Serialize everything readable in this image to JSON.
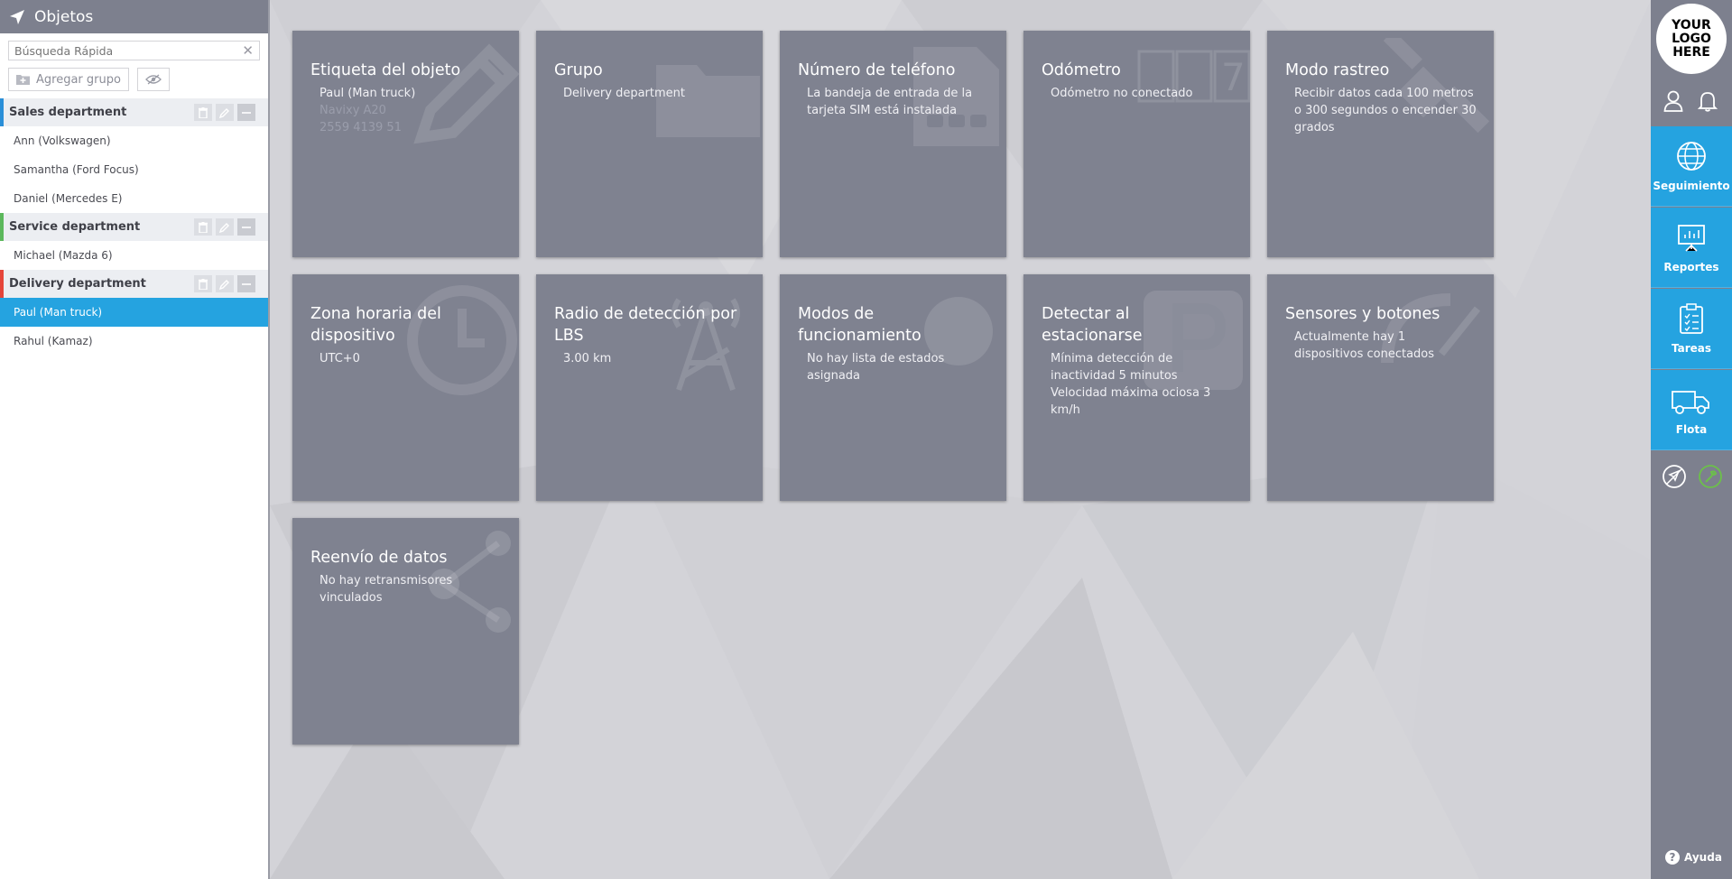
{
  "sidebar": {
    "title": "Objetos",
    "search_placeholder": "Búsqueda Rápida",
    "add_group_label": "Agregar grupo",
    "groups": [
      {
        "name": "Sales department",
        "color": "#2a8fd8",
        "objects": [
          "Ann (Volkswagen)",
          "Samantha (Ford Focus)",
          "Daniel (Mercedes E)"
        ]
      },
      {
        "name": "Service department",
        "color": "#5cb85c",
        "objects": [
          "Michael (Mazda 6)"
        ]
      },
      {
        "name": "Delivery department",
        "color": "#e5453a",
        "objects": [
          "Paul (Man truck)",
          "Rahul (Kamaz)"
        ]
      }
    ],
    "selected_object": "Paul (Man truck)"
  },
  "tiles": [
    {
      "title": "Etiqueta del objeto",
      "desc": "Paul (Man truck)",
      "desc_muted": [
        "Navixy A20",
        "2559 4139 51"
      ],
      "icon": "pencil-icon"
    },
    {
      "title": "Grupo",
      "desc": "Delivery department",
      "icon": "folder-icon"
    },
    {
      "title": "Número de teléfono",
      "desc": "La bandeja de entrada de la tarjeta SIM está instalada",
      "icon": "sim-card-icon"
    },
    {
      "title": "Odómetro",
      "desc": "Odómetro no conectado",
      "icon": "odometer-icon"
    },
    {
      "title": "Modo rastreo",
      "desc": "Recibir datos cada 100 metros o 300 segundos o encender 30 grados",
      "icon": "satellite-icon"
    },
    {
      "title": "Zona horaria del dispositivo",
      "desc": "UTC+0",
      "icon": "clock-icon"
    },
    {
      "title": "Radio de detección por LBS",
      "desc": "3.00 km",
      "icon": "antenna-icon"
    },
    {
      "title": "Modos de funcionamiento",
      "desc": "No hay lista de estados asignada",
      "icon": "circle-icon"
    },
    {
      "title": "Detectar al estacionarse",
      "desc_lines": [
        "Mínima detección de inactividad 5 minutos",
        "Velocidad máxima ociosa 3 km/h"
      ],
      "icon": "parking-icon"
    },
    {
      "title": "Sensores y botones",
      "desc": "Actualmente hay 1 dispositivos conectados",
      "icon": "gauge-icon"
    },
    {
      "title": "Reenvío de datos",
      "desc": "No hay retransmisores vinculados",
      "icon": "share-icon"
    }
  ],
  "rail": {
    "logo_lines": [
      "YOUR",
      "LOGO",
      "HERE"
    ],
    "items": [
      {
        "label": "Seguimiento",
        "icon": "globe-icon"
      },
      {
        "label": "Reportes",
        "icon": "presentation-icon"
      },
      {
        "label": "Tareas",
        "icon": "clipboard-icon"
      },
      {
        "label": "Flota",
        "icon": "truck-icon"
      }
    ],
    "help_label": "Ayuda"
  },
  "colors": {
    "accent": "#25a3e0",
    "sidebar_header": "#7d808e",
    "tile": "#7f8290"
  }
}
